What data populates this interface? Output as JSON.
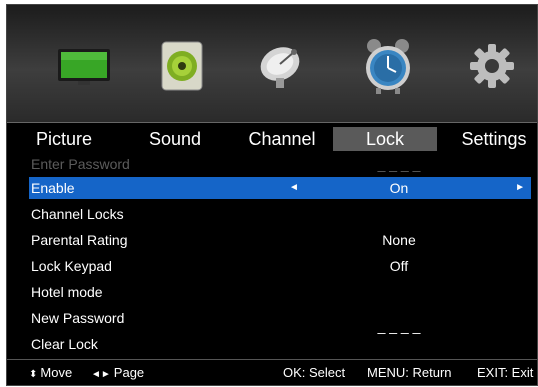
{
  "icons": [
    {
      "name": "picture-icon",
      "color": "#38a626"
    },
    {
      "name": "sound-icon",
      "color": "#7fae22"
    },
    {
      "name": "channel-icon",
      "color": "#cfcfcf"
    },
    {
      "name": "lock-icon",
      "color": "#3a86c2"
    },
    {
      "name": "settings-icon",
      "color": "#bdbdbd"
    }
  ],
  "tabs": [
    "Picture",
    "Sound",
    "Channel",
    "Lock",
    "Settings"
  ],
  "active_tab": "Lock",
  "menu": {
    "enter_password": {
      "label": "Enter Password",
      "value": "_ _ _ _"
    },
    "enable": {
      "label": "Enable",
      "value": "On",
      "left_arrow": "◄",
      "right_arrow": "►"
    },
    "channel_locks": {
      "label": "Channel Locks"
    },
    "parental_rating": {
      "label": "Parental Rating",
      "value": "None"
    },
    "lock_keypad": {
      "label": "Lock Keypad",
      "value": "Off"
    },
    "hotel_mode": {
      "label": "Hotel mode"
    },
    "new_password": {
      "label": "New Password",
      "value": "_ _ _ _"
    },
    "clear_lock": {
      "label": "Clear Lock"
    }
  },
  "footer": {
    "move_glyph": "⬍",
    "move": "Move",
    "page_glyph": "◄►",
    "page": "Page",
    "ok": "OK: Select",
    "menu": "MENU: Return",
    "exit": "EXIT: Exit"
  },
  "colors": {
    "highlight": "#1565c8",
    "active_tab": "#5a5a5a",
    "disabled_text": "#5c5c5c"
  }
}
